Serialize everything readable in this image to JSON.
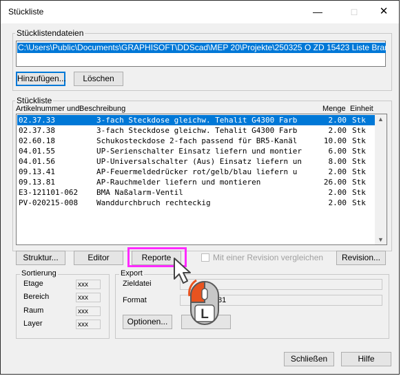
{
  "window": {
    "title": "Stückliste"
  },
  "files_group": {
    "label": "Stücklistendateien",
    "path": "C:\\Users\\Public\\Documents\\GRAPHISOFT\\DDScad\\MEP 20\\Projekte\\250325 O ZD 15423 Liste Brandmelder",
    "add_button": "Hinzufügen...",
    "delete_button": "Löschen"
  },
  "list_group": {
    "label": "Stückliste",
    "headers": {
      "art": "Artikelnummer und",
      "desc": "Beschreibung",
      "qty": "Menge",
      "unit": "Einheit"
    },
    "rows": [
      {
        "art": "02.37.33",
        "desc": "3-fach Steckdose gleichw. Tehalit G4300  Farb",
        "qty": "2.00",
        "unit": "Stk",
        "selected": true
      },
      {
        "art": "02.37.38",
        "desc": "3-fach Steckdose gleichw. Tehalit G4300  Farb",
        "qty": "2.00",
        "unit": "Stk"
      },
      {
        "art": "02.60.18",
        "desc": "Schukosteckdose 2-fach passend für  BR5-Kanäl",
        "qty": "10.00",
        "unit": "Stk"
      },
      {
        "art": "04.01.55",
        "desc": "UP-Serienschalter Einsatz liefern und montier",
        "qty": "6.00",
        "unit": "Stk"
      },
      {
        "art": "04.01.56",
        "desc": "UP-Universalschalter (Aus) Einsatz liefern un",
        "qty": "8.00",
        "unit": "Stk"
      },
      {
        "art": "09.13.41",
        "desc": "AP-Feuermeldedrücker rot/gelb/blau  liefern u",
        "qty": "2.00",
        "unit": "Stk"
      },
      {
        "art": "09.13.81",
        "desc": "AP-Rauchmelder liefern und montieren",
        "qty": "26.00",
        "unit": "Stk"
      },
      {
        "art": "E3-121101-062",
        "desc": "BMA Naßalarm-Ventil",
        "qty": "2.00",
        "unit": "Stk"
      },
      {
        "art": "PV-020215-008",
        "desc": "Wanddurchbruch rechteckig",
        "qty": "2.00",
        "unit": "Stk"
      }
    ]
  },
  "actions": {
    "struktur": "Struktur...",
    "editor": "Editor",
    "reporte": "Reporte",
    "revision_checkbox": "Mit einer Revision vergleichen",
    "revision_button": "Revision..."
  },
  "sort_group": {
    "label": "Sortierung",
    "items": [
      {
        "label": "Etage",
        "value": "xxx"
      },
      {
        "label": "Bereich",
        "value": "xxx"
      },
      {
        "label": "Raum",
        "value": "xxx"
      },
      {
        "label": "Layer",
        "value": "xxx"
      }
    ]
  },
  "export_group": {
    "label": "Export",
    "target_label": "Zieldatei",
    "target_value": "",
    "format_label": "Format",
    "format_value": "81",
    "options_button": "Optionen...",
    "export_button": ""
  },
  "footer": {
    "close": "Schließen",
    "help": "Hilfe"
  },
  "overlay": {
    "mouse_letter": "L",
    "highlight_color": "#ff2aff",
    "mouse_color": "#e8531f"
  }
}
